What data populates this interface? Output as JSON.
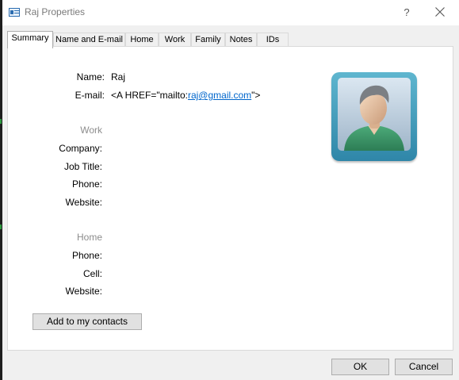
{
  "window": {
    "title": "Raj Properties",
    "help_label": "?",
    "close_label": "✕"
  },
  "tabs": [
    {
      "label": "Summary",
      "active": true
    },
    {
      "label": "Name and E-mail",
      "active": false
    },
    {
      "label": "Home",
      "active": false
    },
    {
      "label": "Work",
      "active": false
    },
    {
      "label": "Family",
      "active": false
    },
    {
      "label": "Notes",
      "active": false
    },
    {
      "label": "IDs",
      "active": false
    }
  ],
  "summary": {
    "name_label": "Name:",
    "name_value": "Raj",
    "email_label": "E-mail:",
    "email_prefix": "<A HREF=\"mailto:",
    "email_address": "raj@gmail.com",
    "email_suffix": "\">",
    "work_section": "Work",
    "company_label": "Company:",
    "job_title_label": "Job Title:",
    "work_phone_label": "Phone:",
    "work_website_label": "Website:",
    "home_section": "Home",
    "home_phone_label": "Phone:",
    "cell_label": "Cell:",
    "home_website_label": "Website:",
    "avatar_icon": "person-placeholder-icon"
  },
  "buttons": {
    "add_to_contacts": "Add to my contacts",
    "ok": "OK",
    "cancel": "Cancel"
  },
  "colors": {
    "link": "#0066cc",
    "section_label": "#8c8c8c",
    "avatar_frame": "#3a93b4"
  }
}
